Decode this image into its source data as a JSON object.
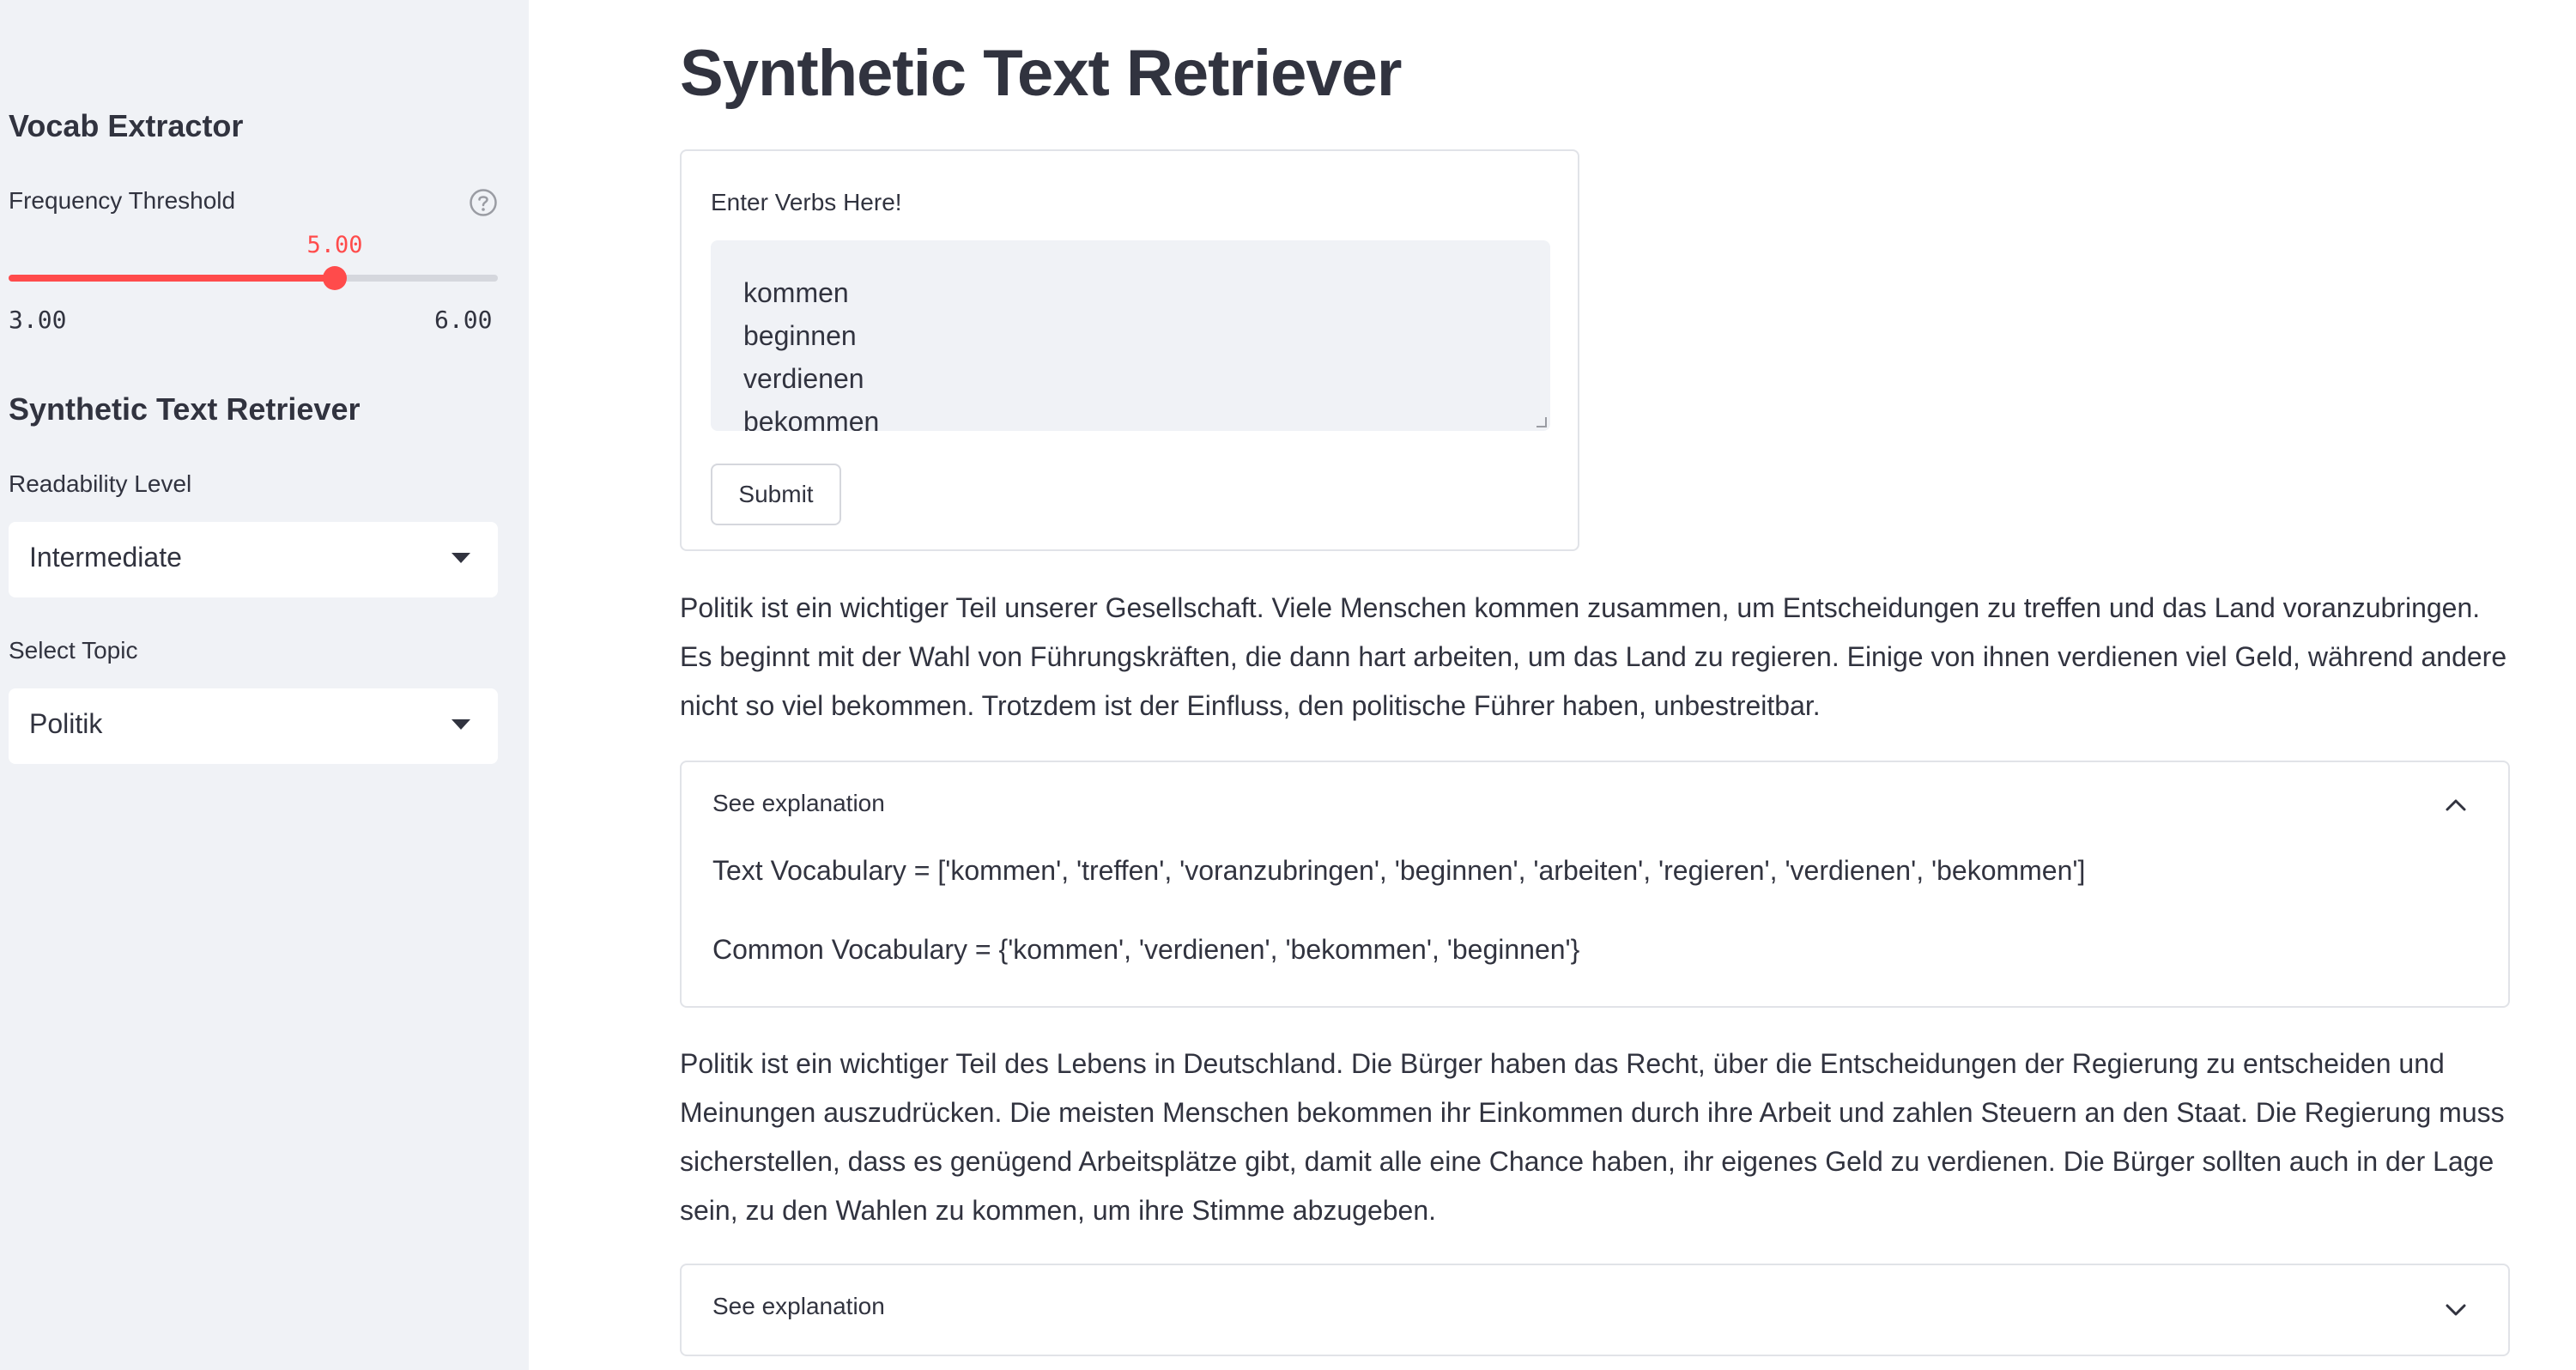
{
  "sidebar": {
    "vocab_heading": "Vocab Extractor",
    "frequency_label": "Frequency Threshold",
    "slider": {
      "value_text": "5.00",
      "min_text": "3.00",
      "max_text": "6.00",
      "value": 5.0,
      "min": 3.0,
      "max": 6.0
    },
    "retriever_heading": "Synthetic Text Retriever",
    "readability_label": "Readability Level",
    "readability_value": "Intermediate",
    "topic_label": "Select Topic",
    "topic_value": "Politik"
  },
  "main": {
    "title": "Synthetic Text Retriever",
    "form": {
      "label": "Enter Verbs Here!",
      "textarea_lines": [
        "kommen",
        "beginnen",
        "verdienen",
        "bekommen"
      ],
      "submit_label": "Submit"
    },
    "results": [
      {
        "text": "Politik ist ein wichtiger Teil unserer Gesellschaft. Viele Menschen kommen zusammen, um Entscheidungen zu treffen und das Land voranzubringen. Es beginnt mit der Wahl von Führungskräften, die dann hart arbeiten, um das Land zu regieren. Einige von ihnen verdienen viel Geld, während andere nicht so viel bekommen. Trotzdem ist der Einfluss, den politische Führer haben, unbestreitbar.",
        "expander_label": "See explanation",
        "expanded": true,
        "text_vocabulary": "Text Vocabulary = ['kommen', 'treffen', 'voranzubringen', 'beginnen', 'arbeiten', 'regieren', 'verdienen', 'bekommen']",
        "common_vocabulary": "Common Vocabulary = {'kommen', 'verdienen', 'bekommen', 'beginnen'}"
      },
      {
        "text": "Politik ist ein wichtiger Teil des Lebens in Deutschland. Die Bürger haben das Recht, über die Entscheidungen der Regierung zu entscheiden und Meinungen auszudrücken. Die meisten Menschen bekommen ihr Einkommen durch ihre Arbeit und zahlen Steuern an den Staat. Die Regierung muss sicherstellen, dass es genügend Arbeitsplätze gibt, damit alle eine Chance haben, ihr eigenes Geld zu verdienen. Die Bürger sollten auch in der Lage sein, zu den Wahlen zu kommen, um ihre Stimme abzugeben.",
        "expander_label": "See explanation",
        "expanded": false
      }
    ]
  },
  "colors": {
    "accent": "#ff4b4b",
    "sidebar_bg": "#f0f2f6",
    "text": "#31333f",
    "border": "#e1e3e8"
  },
  "icons": {
    "help": "question-circle-icon",
    "dropdown": "caret-down-icon",
    "expander_open": "chevron-up-icon",
    "expander_closed": "chevron-down-icon"
  }
}
